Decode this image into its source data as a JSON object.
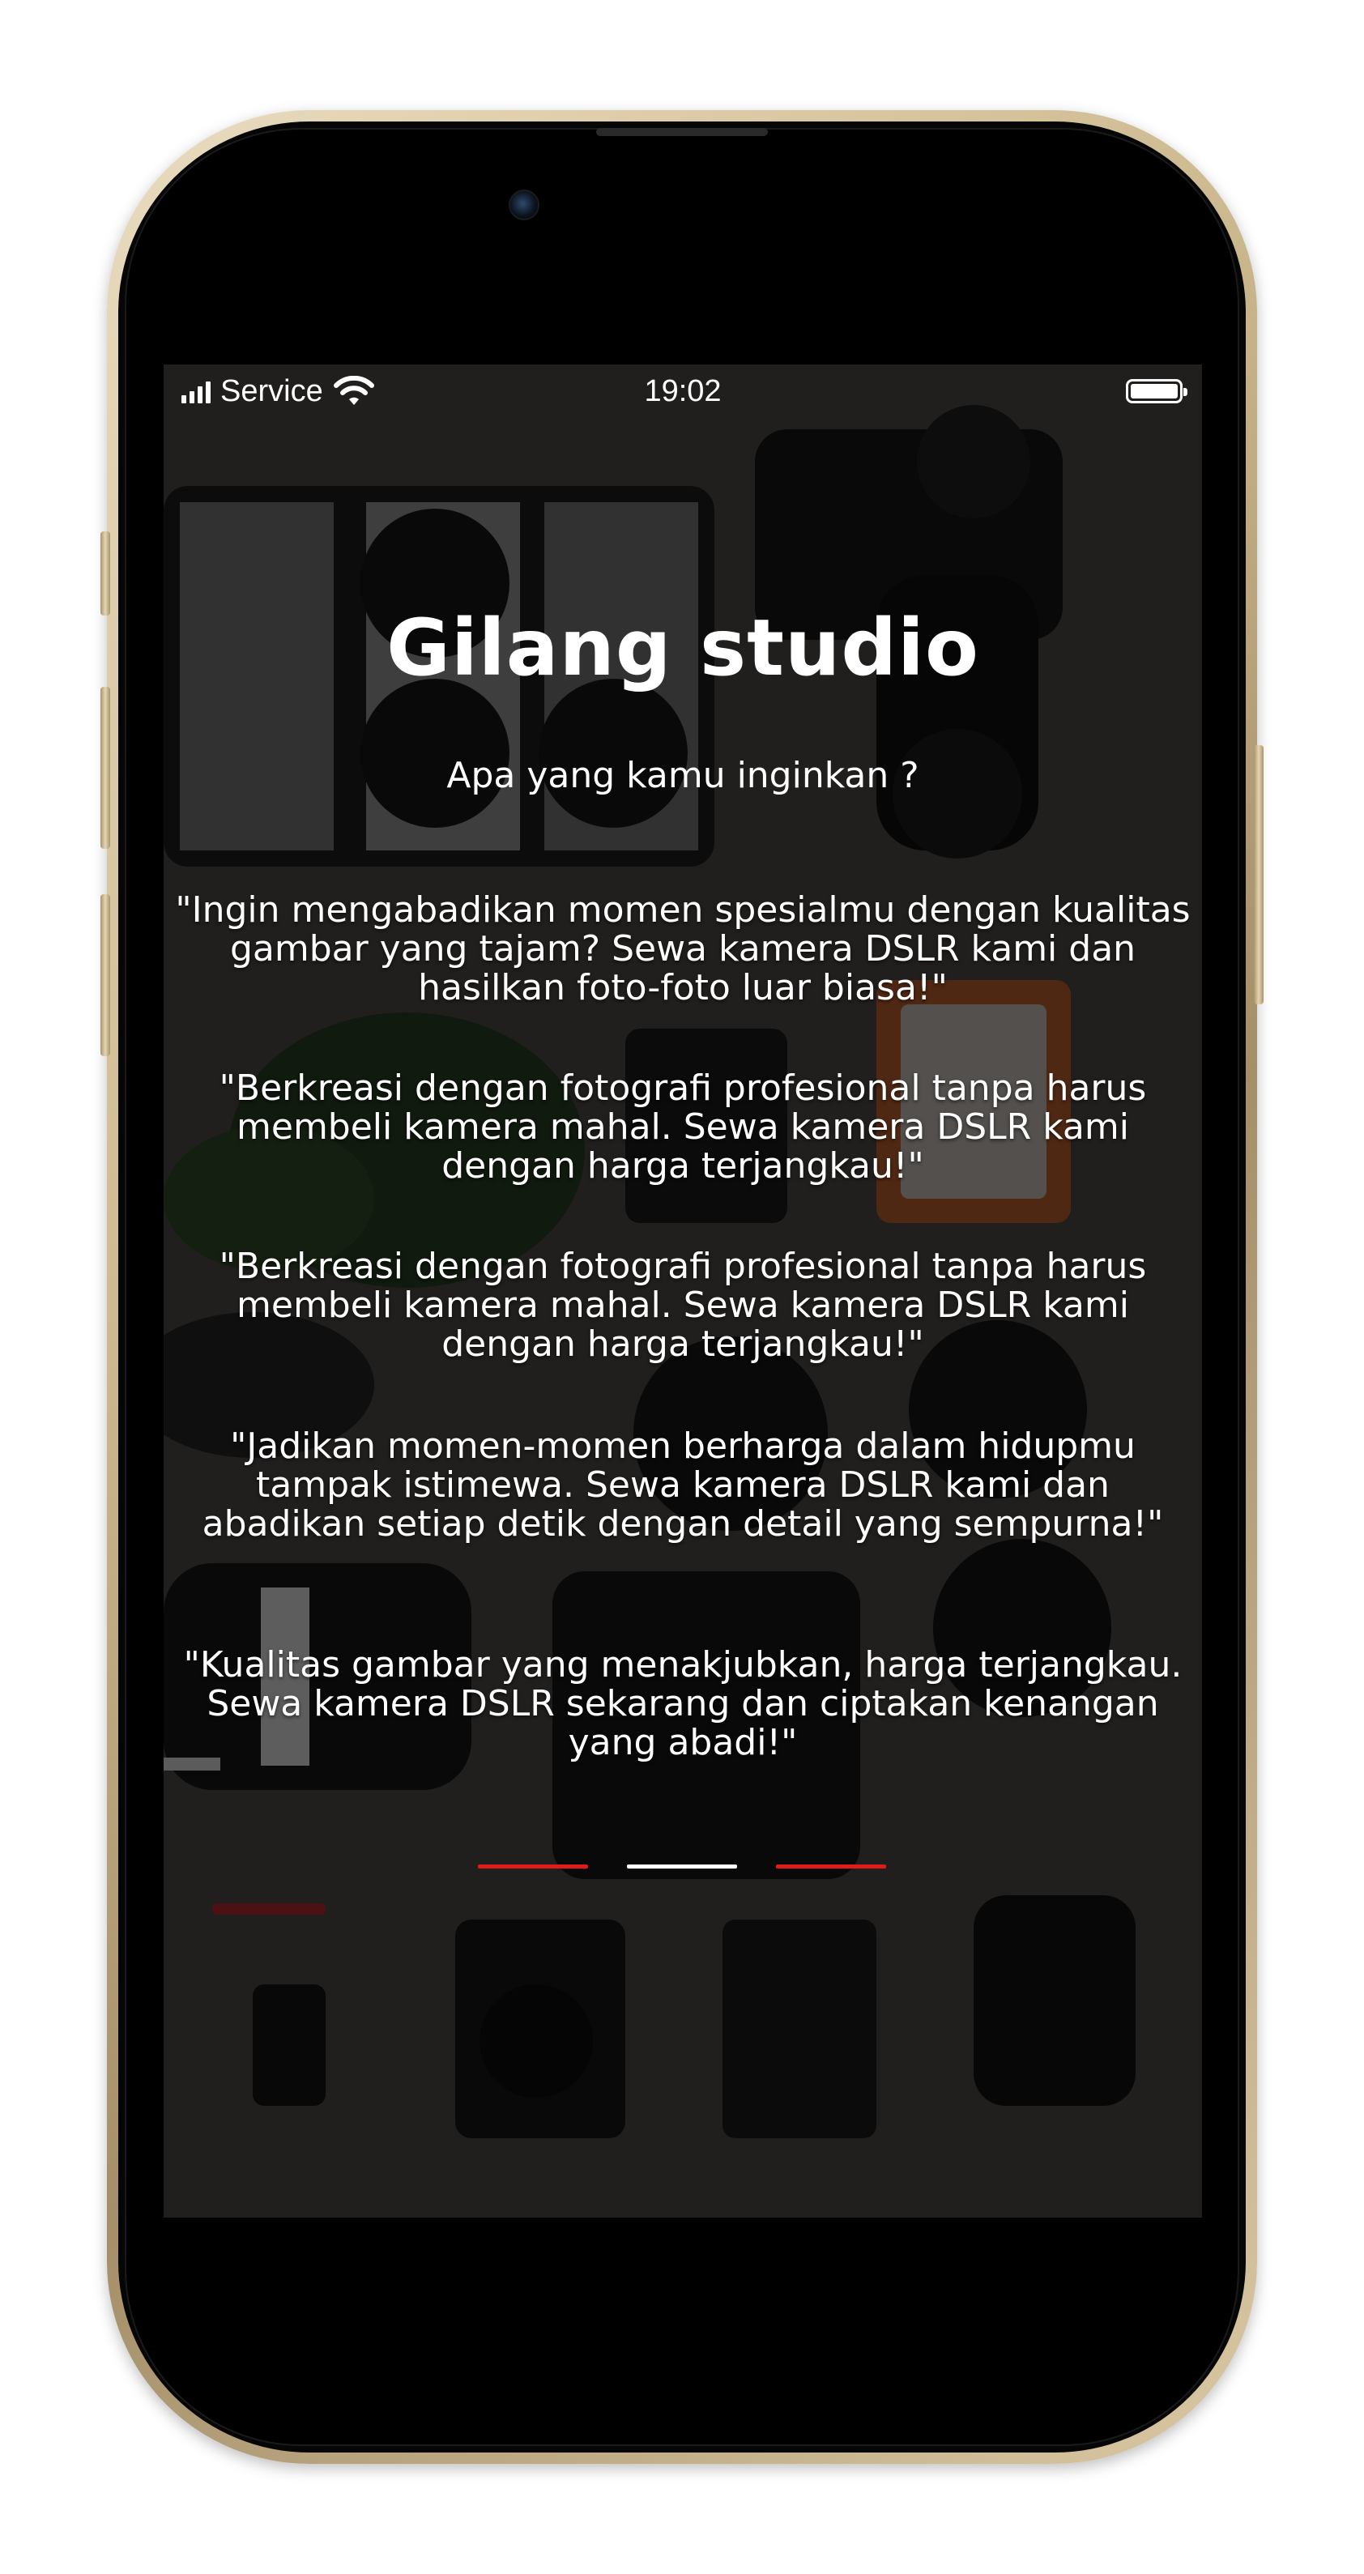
{
  "status_bar": {
    "carrier": "Service",
    "time": "19:02"
  },
  "main": {
    "title": "Gilang studio",
    "subtitle": "Apa yang kamu inginkan ?",
    "paragraphs": [
      "\"Ingin mengabadikan momen spesialmu dengan kualitas gambar yang tajam? Sewa kamera DSLR kami dan hasilkan foto-foto luar biasa!\"",
      "\"Berkreasi dengan fotografi profesional tanpa harus membeli kamera mahal. Sewa kamera DSLR kami dengan harga terjangkau!\"",
      "\"Berkreasi dengan fotografi profesional tanpa harus membeli kamera mahal. Sewa kamera DSLR kami dengan harga terjangkau!\"",
      "\"Jadikan momen-momen berharga dalam hidupmu tampak istimewa. Sewa kamera DSLR kami dan abadikan setiap detik dengan detail yang sempurna!\"",
      "\"Kualitas gambar yang menakjubkan, harga terjangkau. Sewa kamera DSLR sekarang dan ciptakan kenangan yang abadi!\""
    ]
  },
  "pager": {
    "count": 3,
    "active_index": 1,
    "active_color": "#ffffff",
    "inactive_color": "#e11b1b"
  },
  "colors": {
    "frame": "#cdb98f",
    "text": "#ffffff",
    "overlay": "#000000"
  }
}
